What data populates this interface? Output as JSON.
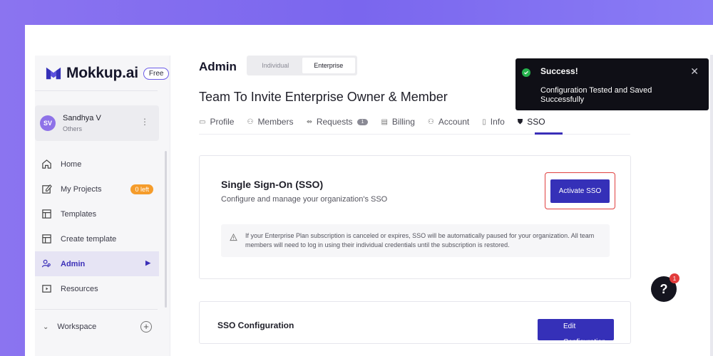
{
  "brand": {
    "name": "Mokkup.ai",
    "plan_badge": "Free",
    "logo_icon": "mokkup-logo-icon",
    "accent": "#3530b8"
  },
  "user": {
    "initials": "SV",
    "name": "Sandhya V",
    "role": "Others",
    "menu_icon": "kebab-icon"
  },
  "sidebar": {
    "items": [
      {
        "label": "Home",
        "icon": "home-icon"
      },
      {
        "label": "My Projects",
        "icon": "edit-icon",
        "badge": "0 left"
      },
      {
        "label": "Templates",
        "icon": "template-icon"
      },
      {
        "label": "Create template",
        "icon": "template-icon"
      },
      {
        "label": "Admin",
        "icon": "users-icon",
        "active": true
      },
      {
        "label": "Resources",
        "icon": "play-icon"
      }
    ],
    "workspace": {
      "label": "Workspace"
    }
  },
  "main": {
    "title": "Admin",
    "toggle": {
      "options": [
        "Individual",
        "Enterprise"
      ],
      "selected": "Enterprise"
    },
    "heading": "Team To Invite Enterprise Owner & Member",
    "tabs": [
      {
        "label": "Profile",
        "icon": "profile-icon"
      },
      {
        "label": "Members",
        "icon": "members-icon"
      },
      {
        "label": "Requests",
        "icon": "requests-icon",
        "count": "1"
      },
      {
        "label": "Billing",
        "icon": "billing-icon"
      },
      {
        "label": "Account",
        "icon": "account-icon"
      },
      {
        "label": "Info",
        "icon": "info-icon"
      },
      {
        "label": "SSO",
        "icon": "shield-icon",
        "active": true
      }
    ],
    "sso_card": {
      "title": "Single Sign-On (SSO)",
      "subtitle": "Configure and manage your organization's SSO",
      "button": "Activate SSO",
      "notice": "If your Enterprise Plan subscription is canceled or expires, SSO will be automatically paused for your organization. All team members will need to log in using their individual credentials until the subscription is restored."
    },
    "config_card": {
      "title": "SSO Configuration",
      "button": "Edit Configuration"
    }
  },
  "toast": {
    "title": "Success!",
    "message": "Configuration Tested and Saved Successfully",
    "status_color": "#26b24d"
  },
  "help": {
    "label": "?",
    "badge": "1"
  }
}
